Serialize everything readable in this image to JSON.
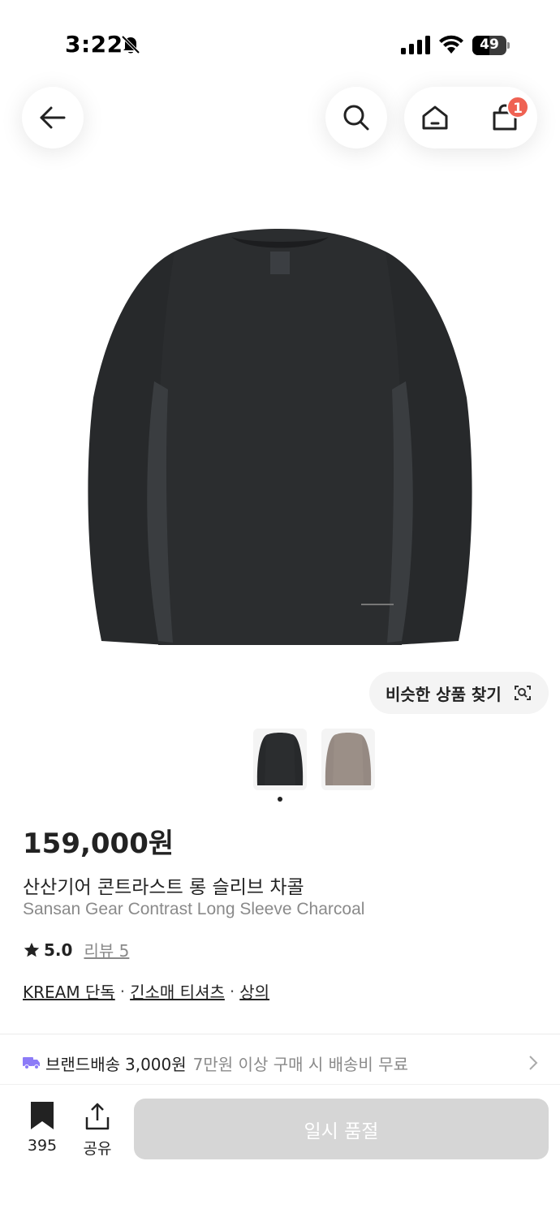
{
  "status_bar": {
    "time": "3:22",
    "battery": "49",
    "battery_level": 0.49
  },
  "nav": {
    "cart_count": "1"
  },
  "product": {
    "similar_button_label": "비슷한 상품 찾기",
    "price": "159,000원",
    "title_ko": "산산기어 콘트라스트 롱 슬리브 차콜",
    "title_en": "Sansan Gear Contrast Long Sleeve Charcoal",
    "rating": "5.0",
    "review_label": "리뷰 5",
    "tags": [
      "KREAM 단독",
      "긴소매 티셔츠",
      "상의"
    ],
    "tag_separator": "·",
    "thumbnails": [
      {
        "color": "#2b2d2f"
      },
      {
        "color": "#9b8f87"
      }
    ]
  },
  "shipping": {
    "label": "브랜드배송",
    "price": "3,000원",
    "note": "7만원 이상 구매 시 배송비 무료"
  },
  "bottom_bar": {
    "bookmark_count": "395",
    "share_label": "공유",
    "soldout_label": "일시 품절"
  },
  "colors": {
    "accent_badge": "#ef6253",
    "shipping_icon": "#8c7bf7",
    "disabled_button": "#d6d6d6"
  }
}
